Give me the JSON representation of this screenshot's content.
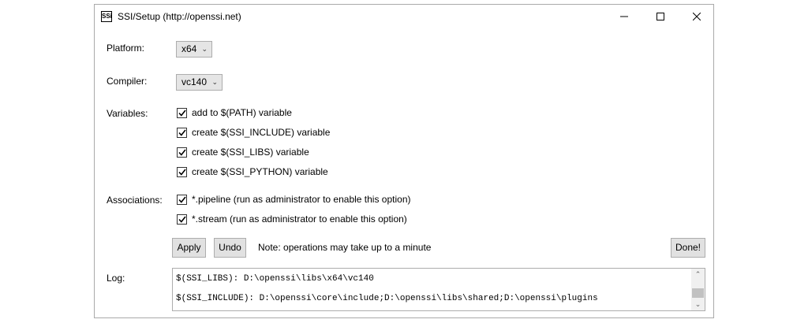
{
  "window": {
    "icon_text": "SSi",
    "title": "SSI/Setup (http://openssi.net)"
  },
  "platform": {
    "label": "Platform:",
    "value": "x64"
  },
  "compiler": {
    "label": "Compiler:",
    "value": "vc140"
  },
  "variables": {
    "label": "Variables:",
    "items": [
      {
        "label": "add to $(PATH) variable",
        "checked": true
      },
      {
        "label": "create $(SSI_INCLUDE) variable",
        "checked": true
      },
      {
        "label": "create $(SSI_LIBS) variable",
        "checked": true
      },
      {
        "label": "create $(SSI_PYTHON) variable",
        "checked": true
      }
    ]
  },
  "associations": {
    "label": "Associations:",
    "items": [
      {
        "label": "*.pipeline (run as administrator to enable this option)",
        "checked": true
      },
      {
        "label": "*.stream (run as administrator to enable this option)",
        "checked": true
      }
    ]
  },
  "actions": {
    "apply": "Apply",
    "undo": "Undo",
    "note": "Note: operations may take up to a minute",
    "done": "Done!"
  },
  "log": {
    "label": "Log:",
    "lines": [
      "$(SSI_LIBS): D:\\openssi\\libs\\x64\\vc140",
      "$(SSI_INCLUDE): D:\\openssi\\core\\include;D:\\openssi\\libs\\shared;D:\\openssi\\plugins"
    ]
  }
}
